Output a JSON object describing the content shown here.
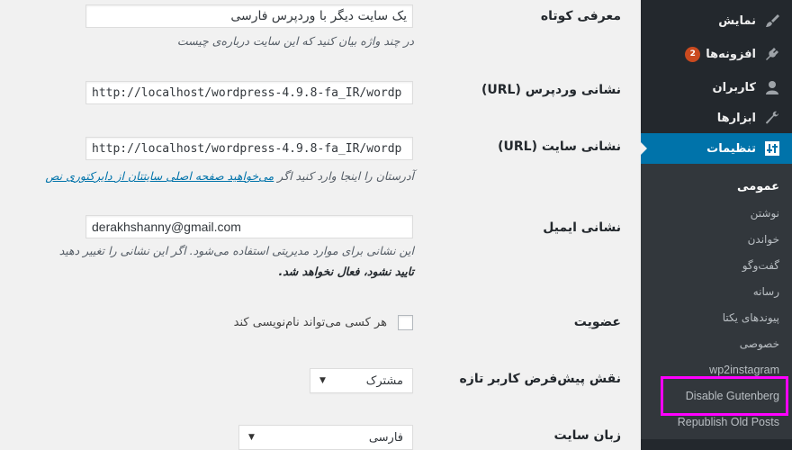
{
  "sidebar": {
    "items": [
      {
        "label": "نمایش",
        "icon": "paintbrush-icon"
      },
      {
        "label": "افزونه‌ها",
        "icon": "plugin-icon",
        "badge": "2"
      },
      {
        "label": "کاربران",
        "icon": "users-icon"
      },
      {
        "label": "ابزارها",
        "icon": "wrench-icon"
      },
      {
        "label": "تنظیمات",
        "icon": "settings-sliders-icon",
        "active": true
      }
    ],
    "submenu": [
      {
        "label": "عمومی",
        "current": true
      },
      {
        "label": "نوشتن"
      },
      {
        "label": "خواندن"
      },
      {
        "label": "گفت‌وگو"
      },
      {
        "label": "رسانه"
      },
      {
        "label": "پیوندهای یکتا"
      },
      {
        "label": "خصوصی"
      },
      {
        "label": "wp2instagram"
      },
      {
        "label": "Disable Gutenberg",
        "highlighted": true
      },
      {
        "label": "Republish Old Posts"
      }
    ],
    "highlight_color": "#ff00ff",
    "accent_color": "#0073aa"
  },
  "form": {
    "tagline": {
      "label": "معرفی کوتاه",
      "value": "یک سایت دیگر با وردپرس فارسی",
      "description": "در چند واژه بیان کنید که این سایت درباره‌ی چیست"
    },
    "wp_url": {
      "label": "نشانی وردپرس (URL)",
      "value": "http://localhost/wordpress-4.9.8-fa_IR/wordp"
    },
    "site_url": {
      "label": "نشانی سایت (URL)",
      "value": "http://localhost/wordpress-4.9.8-fa_IR/wordp",
      "description_prefix": "آدرستان را اینجا وارد کنید اگر ",
      "description_link": "می‌خواهید صفحه اصلی سایتتان از دایرکتوری نص"
    },
    "email": {
      "label": "نشانی ایمیل",
      "value": "derakhshanny@gmail.com",
      "description_line1": "این نشانی برای موارد مدیریتی استفاده می‌شود. اگر این نشانی را تغییر دهید",
      "description_line2": "تایید نشود، فعال نخواهد شد."
    },
    "membership": {
      "label": "عضویت",
      "checkbox_label": "هر کسی می‌تواند نام‌نویسی کند",
      "checked": false
    },
    "default_role": {
      "label": "نقش پیش‌فرض کاربر تازه",
      "selected": "مشترک"
    },
    "site_language": {
      "label": "زبان سایت",
      "selected": "فارسی"
    }
  }
}
